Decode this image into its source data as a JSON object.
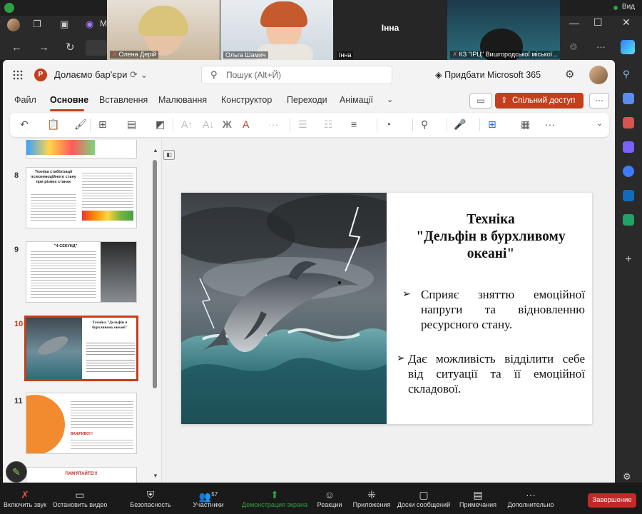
{
  "zoom_top": {
    "view_label": "Вид"
  },
  "participants_video": [
    {
      "name": "Олена Дерій",
      "muted": true
    },
    {
      "name": "Ольга Шамич",
      "muted": false
    },
    {
      "name": "Інна",
      "center_label": "Інна"
    },
    {
      "name": "КЗ \"ІРЦ\" Вишгородської міської...",
      "muted": true
    }
  ],
  "edge_tab_partial": "M",
  "ppt": {
    "doc_title": "Долаємо бар'єри",
    "search_placeholder": "Пошук (Alt+Й)",
    "buy_label": "Придбати Microsoft 365",
    "menu": [
      "Файл",
      "Основне",
      "Вставлення",
      "Малювання",
      "Конструктор",
      "Переходи",
      "Анімації"
    ],
    "share_label": "Спільний доступ",
    "thumbnails": [
      {
        "num": "8",
        "title": "Техніка стабілізації психоемоційного стану при різних станах"
      },
      {
        "num": "9",
        "title": "\"4-СЕКУНД\""
      },
      {
        "num": "10",
        "title": "Техніка \"Дельфін в бурхливому океані\"",
        "selected": true
      },
      {
        "num": "11",
        "title": "ВАЖЛИВО!!!"
      },
      {
        "num": "",
        "title": "ПАМ'ЯТАЙТЕ!!!"
      }
    ],
    "slide": {
      "title_line1": "Техніка",
      "title_line2": "\"Дельфін в бурхливому",
      "title_line3": "океані\"",
      "bullet1": "Сприяє зняттю емоційної напруги та відновленню ресурсного стану.",
      "bullet2": "Дає можливість відділити себе від ситуації та її емоційної складової."
    }
  },
  "zoom_controls": [
    {
      "label": "Включить звук",
      "icon": "mic-off-icon"
    },
    {
      "label": "Остановить видео",
      "icon": "video-icon"
    },
    {
      "label": "Безопасность",
      "icon": "shield-icon"
    },
    {
      "label": "Участники",
      "icon": "people-icon",
      "count": "57"
    },
    {
      "label": "Демонстрация экрана",
      "icon": "share-screen-icon",
      "active": true
    },
    {
      "label": "Реакции",
      "icon": "emoji-icon"
    },
    {
      "label": "Приложения",
      "icon": "apps-icon"
    },
    {
      "label": "Доски сообщений",
      "icon": "whiteboard-icon"
    },
    {
      "label": "Примечания",
      "icon": "notes-icon"
    },
    {
      "label": "Дополнительно",
      "icon": "more-icon"
    }
  ],
  "end_label": "Завершение"
}
